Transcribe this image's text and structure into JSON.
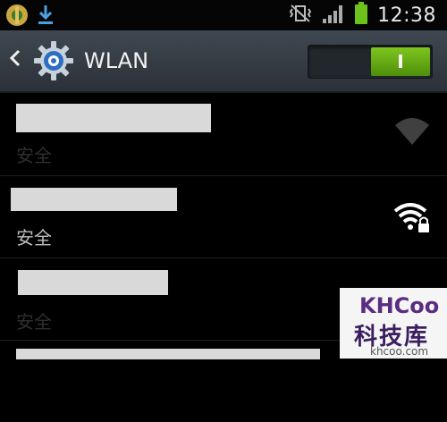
{
  "status_bar": {
    "time": "12:38",
    "icons": [
      "app-notification-icon",
      "download-notification-icon",
      "vibrate-mode-icon",
      "signal-icon",
      "battery-icon"
    ]
  },
  "header": {
    "title": "WLAN",
    "toggle_label": "I",
    "toggle_state": "on",
    "accent_color": "#6db21a"
  },
  "networks": [
    {
      "security": "安全",
      "signal": "weak",
      "dimmed": true
    },
    {
      "security": "安全",
      "signal": "full-locked",
      "dimmed": false
    },
    {
      "security": "安全",
      "signal": "none",
      "dimmed": true
    }
  ],
  "watermark": {
    "logo_text": "KHCoo",
    "site_name": "科技库",
    "url": "khcoo.com"
  }
}
